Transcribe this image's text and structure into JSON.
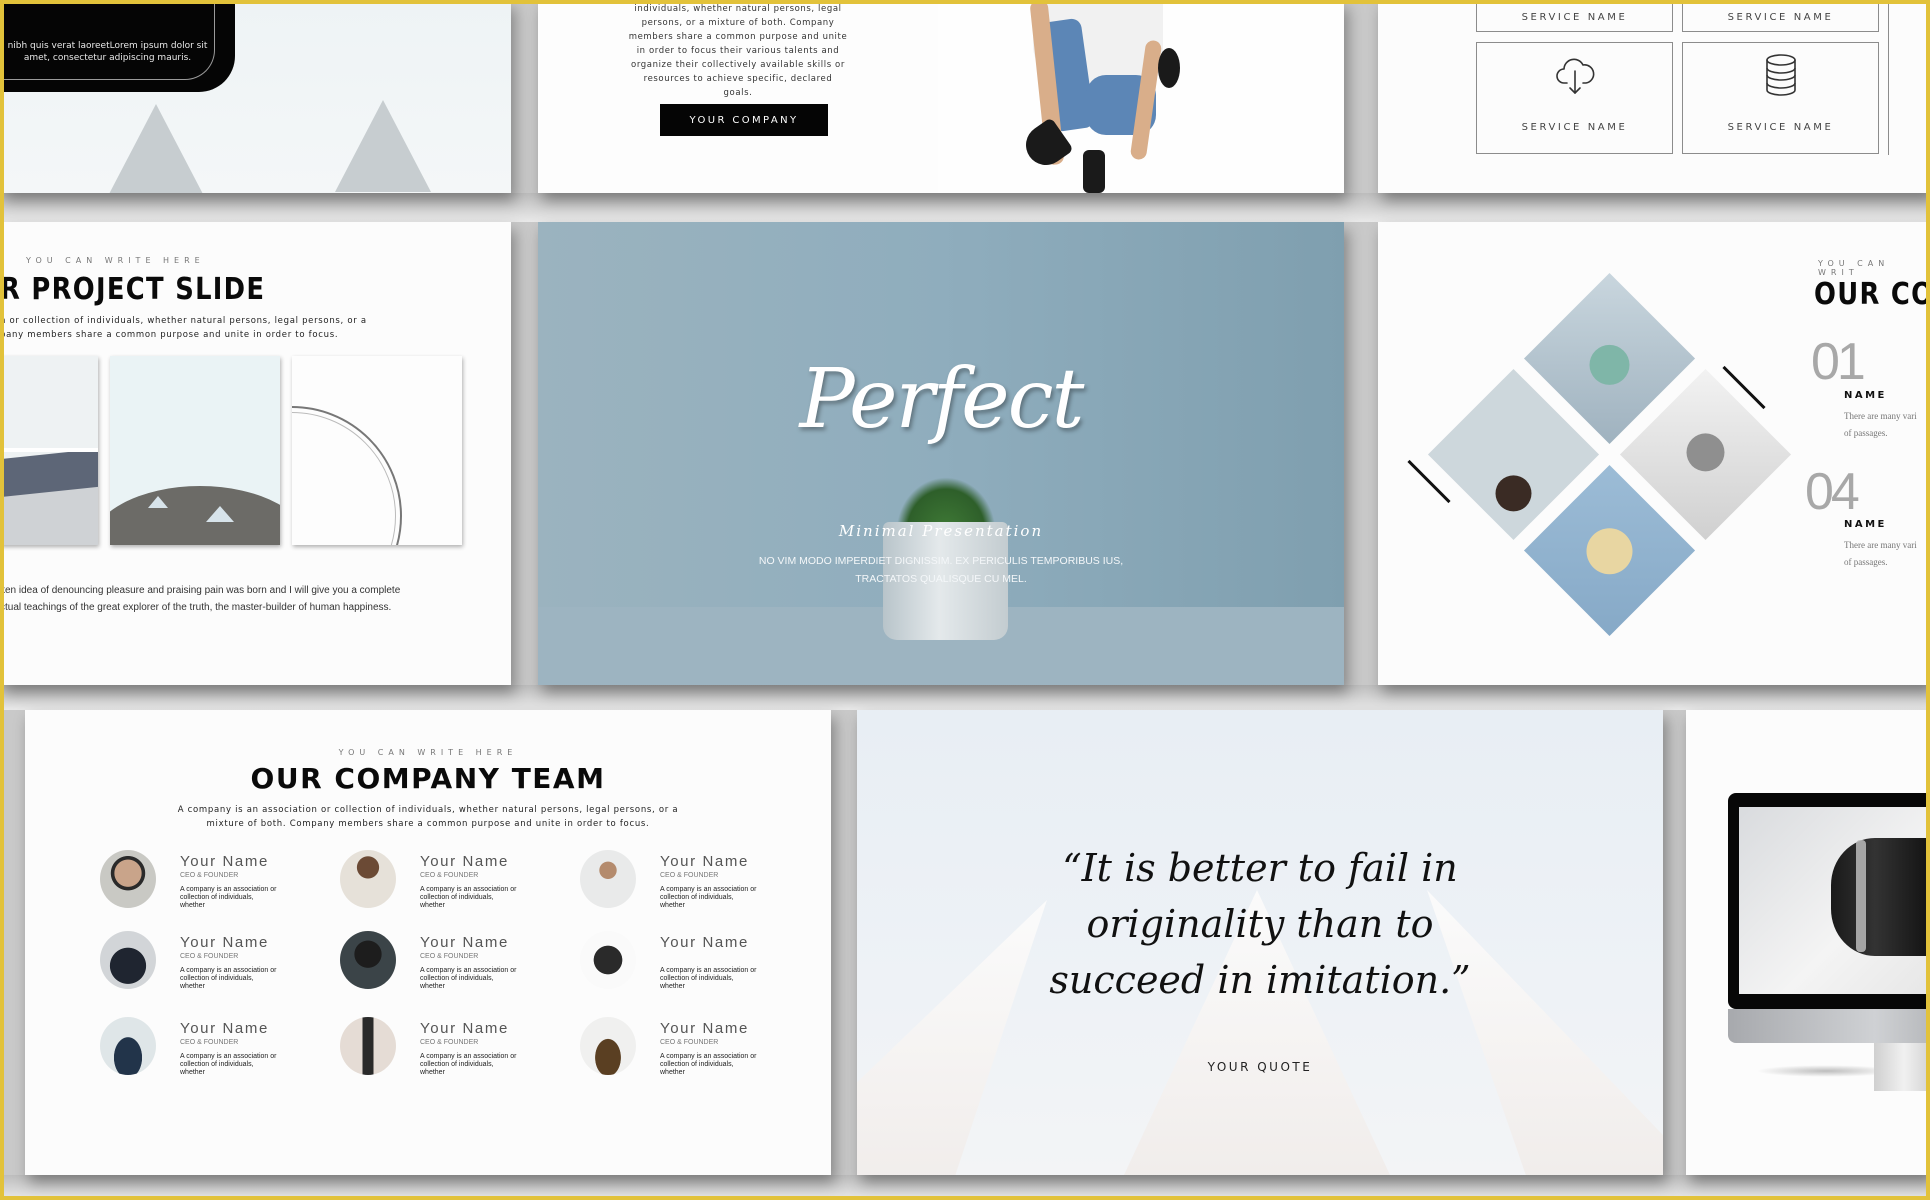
{
  "colors": {
    "frame": "#e2c23a",
    "accent_dark": "#050505",
    "cover_blue": "#8fadbd",
    "number_gray": "#a8a8a8"
  },
  "slides": {
    "intro_card": {
      "card_text": "nibh quis verat laoreetLorem ipsum dolor sit amet, consectetur adipiscing mauris."
    },
    "about": {
      "paragraph": "individuals, whether natural persons, legal persons, or a mixture of both. Company members share a common purpose and unite in order to focus their various talents and organize their collectively available skills or resources to achieve specific, declared goals.",
      "button_label": "YOUR COMPANY"
    },
    "services": {
      "items": [
        {
          "label": "SERVICE NAME",
          "icon": "none"
        },
        {
          "label": "SERVICE NAME",
          "icon": "none"
        },
        {
          "label": "SERVICE NAME",
          "icon": "cloud-download-icon"
        },
        {
          "label": "SERVICE NAME",
          "icon": "database-icon"
        }
      ]
    },
    "project": {
      "kicker": "YOU CAN WRITE HERE",
      "title": "R PROJECT SLIDE",
      "intro_line1": "n or collection of individuals, whether natural persons, legal persons, or a",
      "intro_line2": "pany members share a common purpose and unite in order to focus.",
      "body_line1": "ken idea of denouncing pleasure and praising pain was born and I will give you a complete",
      "body_line2": "ctual  teachings of the great explorer of the truth, the master-builder of human happiness."
    },
    "cover": {
      "title": "Perfect",
      "subtitle": "Minimal Presentation",
      "desc_line1": "NO VIM MODO IMPERDIET  DIGNISSIM. EX PERICULIS TEMPORIBUS IUS,",
      "desc_line2": "TRACTATOS QUALISQUE CU MEL."
    },
    "company": {
      "kicker": "YOU CAN WRIT",
      "title": "OUR CO",
      "entries": [
        {
          "number": "01",
          "name": "NAME",
          "desc_line1": "There are many vari",
          "desc_line2": "of passages."
        },
        {
          "number": "04",
          "name": "NAME",
          "desc_line1": "There are many vari",
          "desc_line2": "of passages."
        }
      ]
    },
    "team": {
      "kicker": "YOU CAN WRITE HERE",
      "title": "OUR COMPANY TEAM",
      "intro_line1": "A company is an association or collection of individuals, whether natural persons, legal persons, or a",
      "intro_line2": "mixture of both. Company members share a common purpose and unite in order to focus.",
      "members": [
        {
          "name": "Your Name",
          "role": "CEO & FOUNDER",
          "desc": "A company is an association or collection of individuals, whether"
        },
        {
          "name": "Your Name",
          "role": "CEO & FOUNDER",
          "desc": "A company is an association or collection of individuals, whether"
        },
        {
          "name": "Your Name",
          "role": "CEO & FOUNDER",
          "desc": "A company is an association or collection of individuals, whether"
        },
        {
          "name": "Your Name",
          "role": "CEO & FOUNDER",
          "desc": "A company is an association or collection of individuals, whether"
        },
        {
          "name": "Your Name",
          "role": "CEO & FOUNDER",
          "desc": "A company is an association or collection of individuals, whether"
        },
        {
          "name": "Your Name",
          "role": "",
          "desc": "A company is an association or collection of individuals, whether"
        },
        {
          "name": "Your Name",
          "role": "CEO & FOUNDER",
          "desc": "A company is an association or collection of individuals, whether"
        },
        {
          "name": "Your Name",
          "role": "CEO & FOUNDER",
          "desc": "A company is an association or collection of individuals, whether"
        },
        {
          "name": "Your Name",
          "role": "CEO & FOUNDER",
          "desc": "A company is an association or collection of individuals, whether"
        }
      ]
    },
    "quote": {
      "line1": "“It is better to fail in",
      "line2": "originality than to",
      "line3": "succeed in imitation.”",
      "author": "YOUR QUOTE"
    },
    "device_mockup": {}
  }
}
